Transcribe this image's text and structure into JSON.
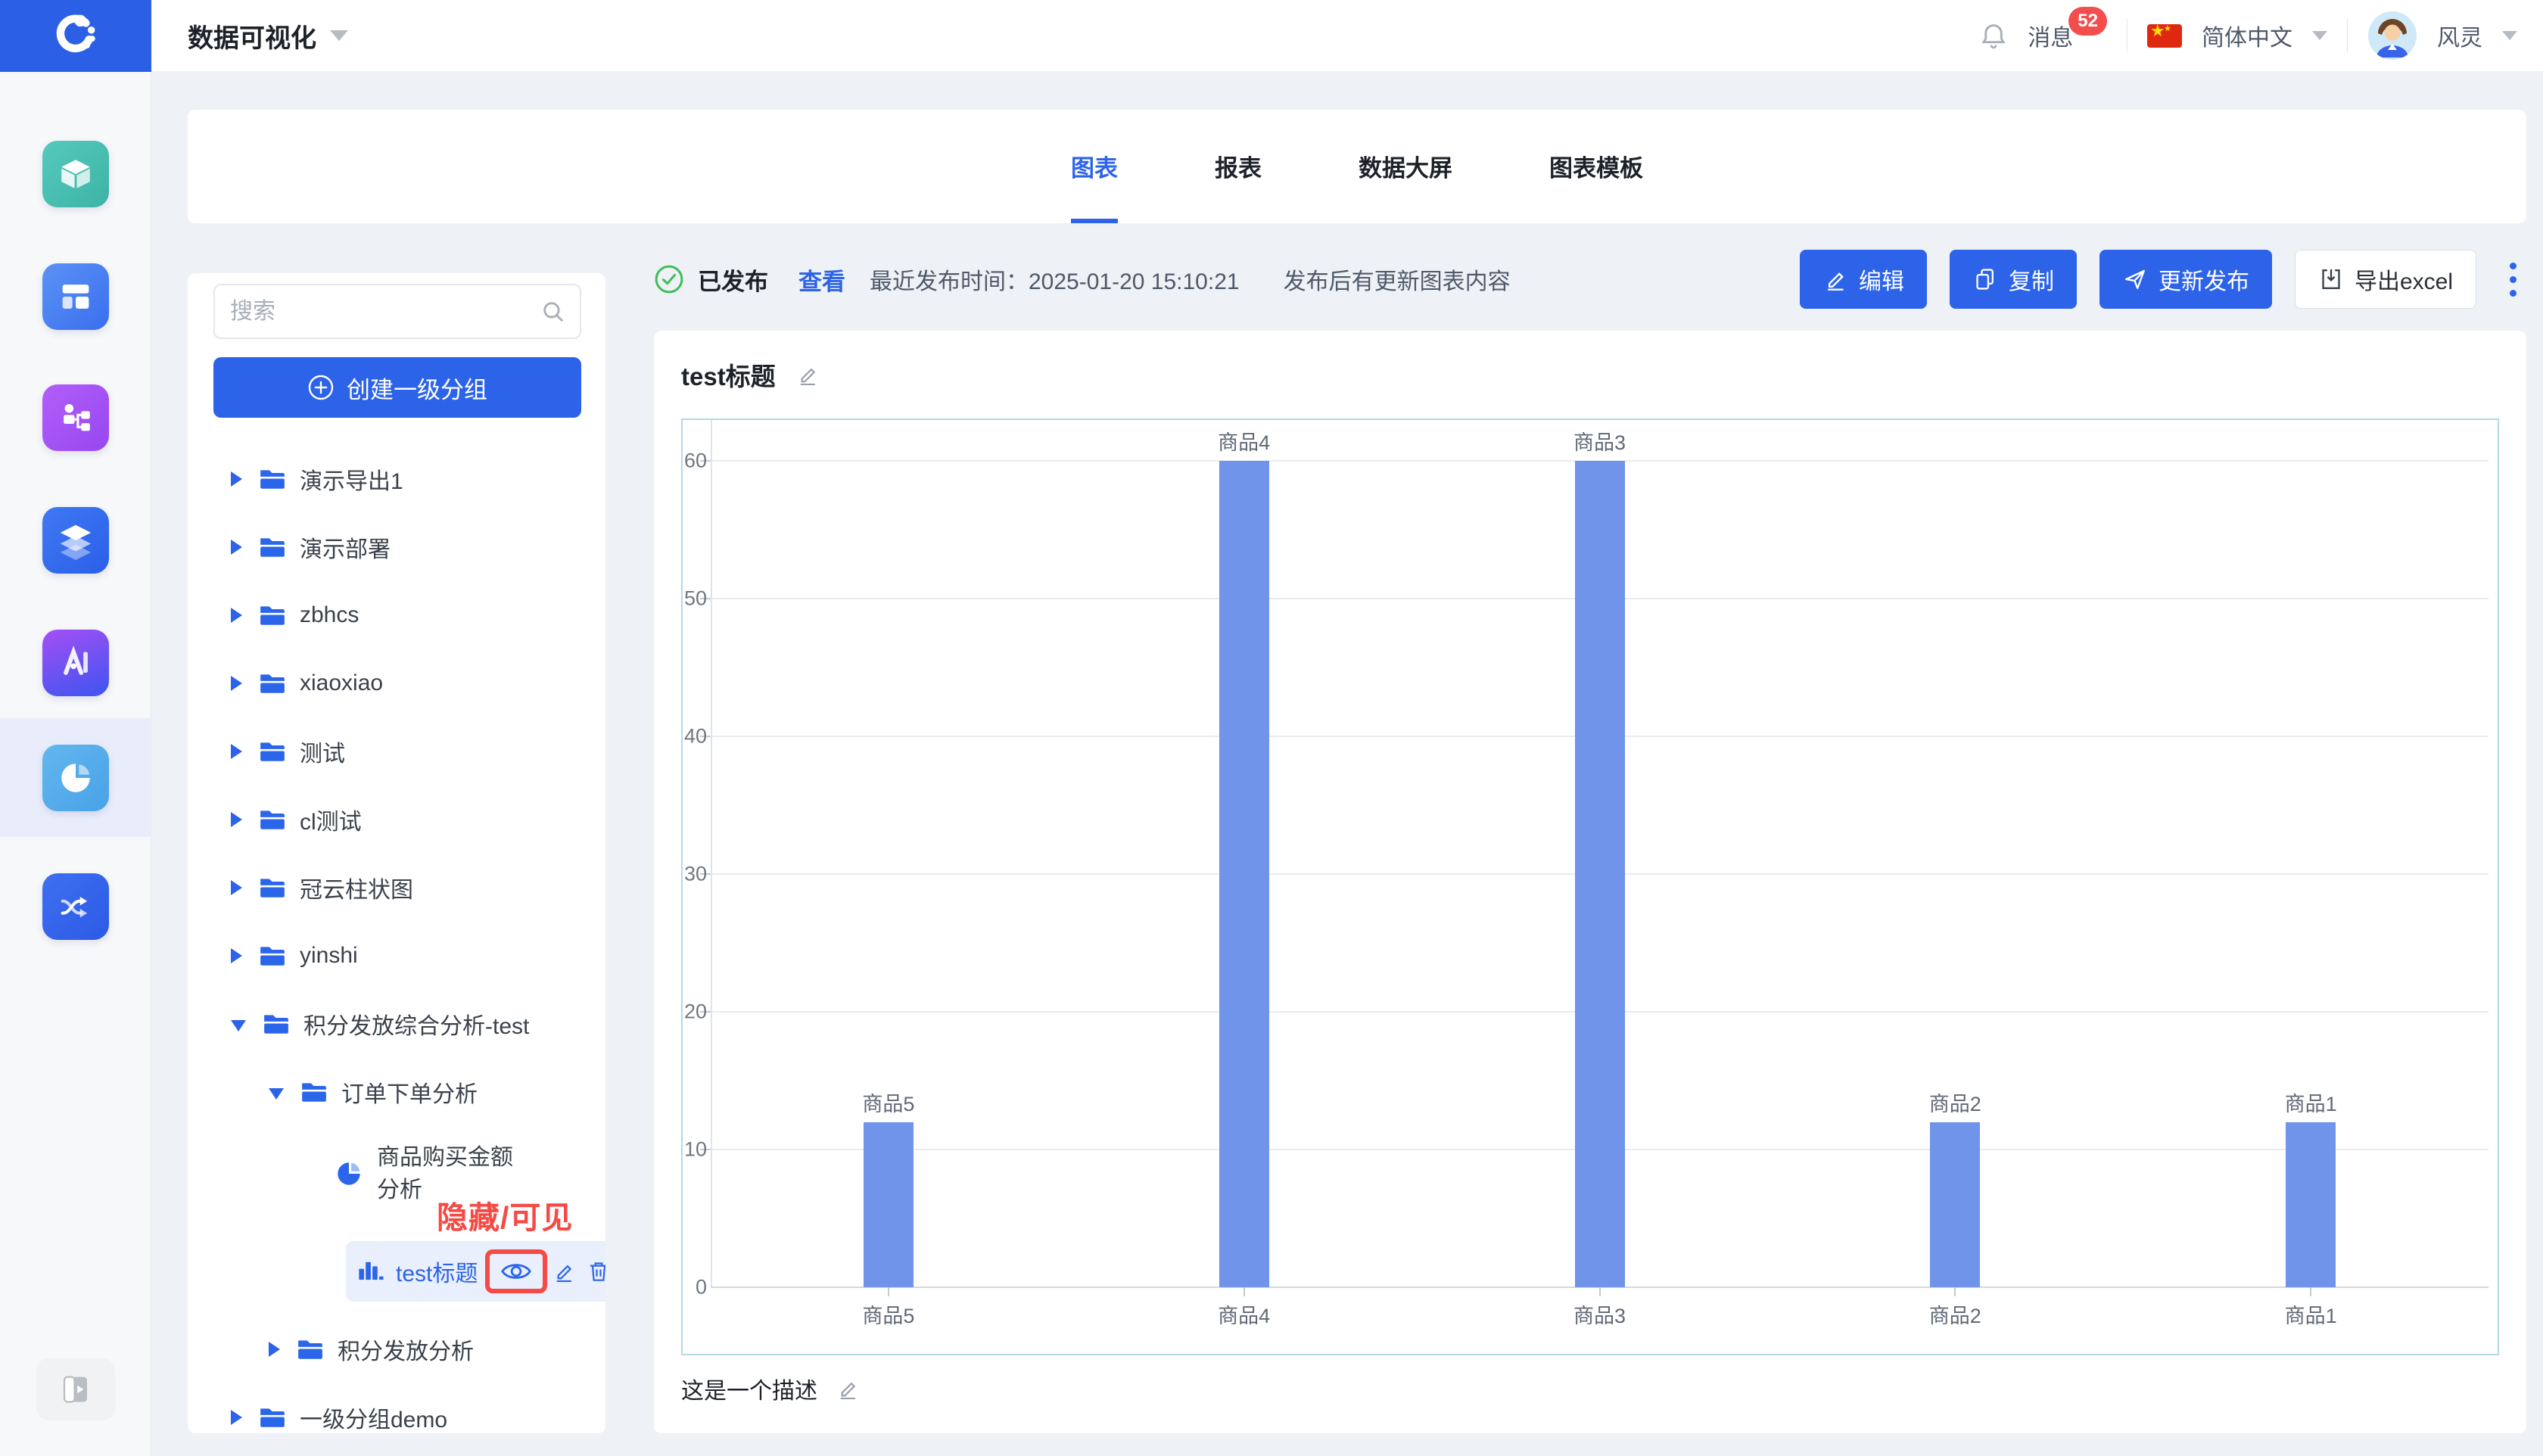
{
  "header": {
    "app_title": "数据可视化",
    "messages": {
      "label": "消息",
      "badge": "52"
    },
    "language": {
      "label": "简体中文"
    },
    "user": {
      "name": "风灵"
    }
  },
  "rail": {
    "active_index": 5,
    "items": [
      {
        "icon": "cube-icon",
        "color": "#49c0b2"
      },
      {
        "icon": "dashboard-layout-icon",
        "color": "#4a87f2"
      },
      {
        "icon": "org-flow-icon",
        "color": "#a455f6"
      },
      {
        "icon": "layers-icon",
        "color": "#2f6bef"
      },
      {
        "icon": "ai-letter-icon",
        "color": "#8a4ff2"
      },
      {
        "icon": "pie-analytics-icon",
        "color": "#57ade9"
      },
      {
        "icon": "shuffle-icon",
        "color": "#3767ec"
      }
    ]
  },
  "tabs": {
    "items": [
      {
        "label": "图表",
        "active": true
      },
      {
        "label": "报表",
        "active": false
      },
      {
        "label": "数据大屏",
        "active": false
      },
      {
        "label": "图表模板",
        "active": false
      }
    ]
  },
  "toolbar": {
    "status": "已发布",
    "view_link": "查看",
    "publish_time": "最近发布时间：2025-01-20 15:10:21",
    "update_hint": "发布后有更新图表内容",
    "edit_label": "编辑",
    "copy_label": "复制",
    "publish_label": "更新发布",
    "export_label": "导出excel"
  },
  "sidebar": {
    "search_placeholder": "搜索",
    "create_group_label": "创建一级分组",
    "tree": [
      {
        "label": "演示导出1",
        "type": "folder",
        "depth": 0,
        "expanded": false
      },
      {
        "label": "演示部署",
        "type": "folder",
        "depth": 0,
        "expanded": false
      },
      {
        "label": "zbhcs",
        "type": "folder",
        "depth": 0,
        "expanded": false
      },
      {
        "label": "xiaoxiao",
        "type": "folder",
        "depth": 0,
        "expanded": false
      },
      {
        "label": "测试",
        "type": "folder",
        "depth": 0,
        "expanded": false
      },
      {
        "label": "cl测试",
        "type": "folder",
        "depth": 0,
        "expanded": false
      },
      {
        "label": "冠云柱状图",
        "type": "folder",
        "depth": 0,
        "expanded": false
      },
      {
        "label": "yinshi",
        "type": "folder",
        "depth": 0,
        "expanded": false
      },
      {
        "label": "积分发放综合分析-test",
        "type": "folder",
        "depth": 0,
        "expanded": true
      },
      {
        "label": "订单下单分析",
        "type": "folder",
        "depth": 1,
        "expanded": true
      },
      {
        "label": "商品购买金额分析",
        "type": "pie-chart",
        "depth": 2,
        "expanded": false
      },
      {
        "label": "test标题",
        "type": "bar-chart",
        "depth": 2,
        "selected": true
      },
      {
        "label": "积分发放分析",
        "type": "folder",
        "depth": 1,
        "expanded": false
      },
      {
        "label": "一级分组demo",
        "type": "folder",
        "depth": 0,
        "expanded": false
      }
    ]
  },
  "annotation": {
    "label": "隐藏/可见",
    "color": "#f54a45"
  },
  "chart": {
    "title": "test标题",
    "description": "这是一个描述"
  },
  "chart_data": {
    "type": "bar",
    "title": "test标题",
    "categories": [
      "商品5",
      "商品4",
      "商品3",
      "商品2",
      "商品1"
    ],
    "values": [
      12,
      60,
      60,
      12,
      12
    ],
    "bar_labels": [
      "商品5",
      "商品4",
      "商品3",
      "商品2",
      "商品1"
    ],
    "xlabel": "",
    "ylabel": "",
    "ylim": [
      0,
      60
    ],
    "yticks": [
      0,
      10,
      20,
      30,
      40,
      50,
      60
    ],
    "grid": true,
    "legend": "none",
    "bar_color": "#6f94ea"
  }
}
